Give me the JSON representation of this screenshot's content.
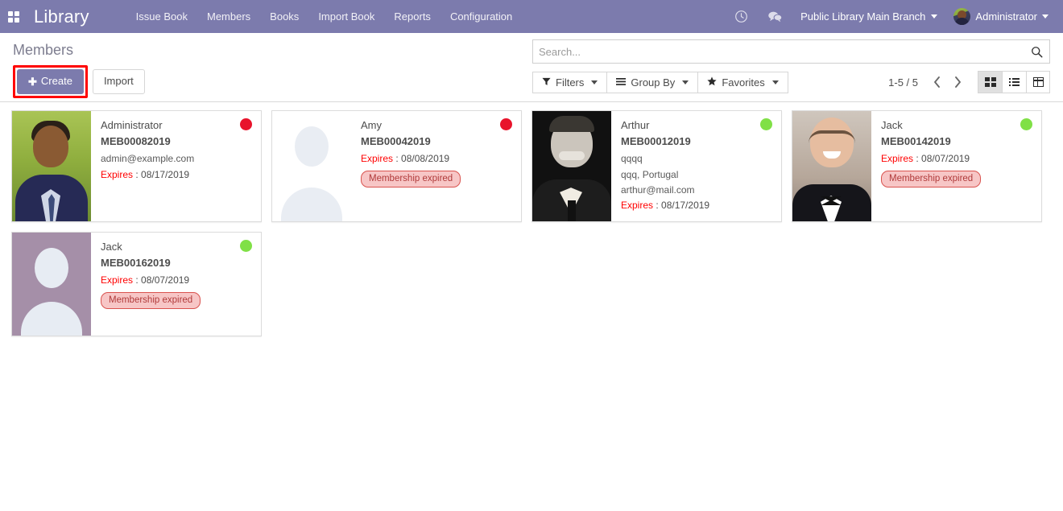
{
  "navbar": {
    "apps_icon": "apps-grid-icon",
    "brand": "Library",
    "menu": [
      {
        "label": "Issue Book"
      },
      {
        "label": "Members"
      },
      {
        "label": "Books"
      },
      {
        "label": "Import Book"
      },
      {
        "label": "Reports"
      },
      {
        "label": "Configuration"
      }
    ],
    "activity_icon": "clock-icon",
    "messages_icon": "chat-bubble-icon",
    "branch": "Public Library Main Branch",
    "user": "Administrator",
    "avatar_icon": "user-avatar"
  },
  "control_panel": {
    "page_title": "Members",
    "create_label": "Create",
    "create_icon": "plus-icon",
    "import_label": "Import",
    "search": {
      "placeholder": "Search...",
      "value": "",
      "icon": "search-icon"
    },
    "filters": [
      {
        "label": "Filters",
        "icon": "funnel-icon"
      },
      {
        "label": "Group By",
        "icon": "bars-icon"
      },
      {
        "label": "Favorites",
        "icon": "star-icon"
      }
    ],
    "pager": {
      "count": "1-5 / 5",
      "prev_icon": "chevron-left-icon",
      "next_icon": "chevron-right-icon"
    },
    "views": [
      {
        "name": "kanban",
        "icon": "kanban-icon",
        "active": true
      },
      {
        "name": "list",
        "icon": "list-icon",
        "active": false
      },
      {
        "name": "pivot",
        "icon": "pivot-table-icon",
        "active": false
      }
    ]
  },
  "members": [
    {
      "name": "Administrator",
      "code": "MEB00082019",
      "street": "",
      "city_country": "",
      "email": "admin@example.com",
      "expires_label": "Expires",
      "expires_sep": " : ",
      "expires_date": "08/17/2019",
      "badge": "",
      "status": "red",
      "photo": "photo-administrator"
    },
    {
      "name": "Amy",
      "code": "MEB00042019",
      "street": "",
      "city_country": "",
      "email": "",
      "expires_label": "Expires",
      "expires_sep": " : ",
      "expires_date": "08/08/2019",
      "badge": "Membership expired",
      "status": "red",
      "photo": "photo-placeholder-white"
    },
    {
      "name": "Arthur",
      "code": "MEB00012019",
      "street": "qqqq",
      "city_country": "qqq, Portugal",
      "email": "arthur@mail.com",
      "expires_label": "Expires",
      "expires_sep": " : ",
      "expires_date": "08/17/2019",
      "badge": "",
      "status": "green",
      "photo": "photo-arthur"
    },
    {
      "name": "Jack",
      "code": "MEB00142019",
      "street": "",
      "city_country": "",
      "email": "",
      "expires_label": "Expires",
      "expires_sep": " : ",
      "expires_date": "08/07/2019",
      "badge": "Membership expired",
      "status": "green",
      "photo": "photo-jack"
    },
    {
      "name": "Jack",
      "code": "MEB00162019",
      "street": "",
      "city_country": "",
      "email": "",
      "expires_label": "Expires",
      "expires_sep": " : ",
      "expires_date": "08/07/2019",
      "badge": "Membership expired",
      "status": "green",
      "photo": "photo-placeholder-purple"
    }
  ],
  "colors": {
    "navbar_purple": "#7c7bad",
    "status_red": "#e8132b",
    "status_green": "#80e046",
    "expired_badge_bg": "#f7c6c6",
    "expired_badge_border": "#d9534f",
    "highlight_red": "#ff0000",
    "expires_label_red": "#ff0000"
  }
}
